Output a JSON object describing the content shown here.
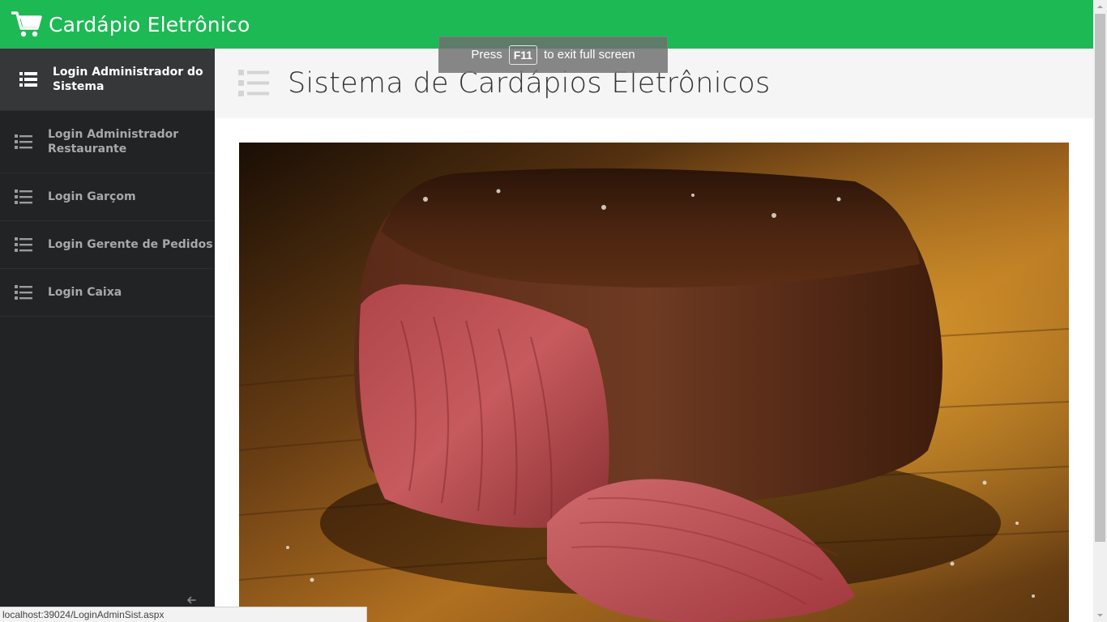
{
  "app": {
    "title": "Cardápio Eletrônico",
    "brand_color": "#1db954",
    "brand_icon": "shopping-cart-icon"
  },
  "sidebar": {
    "items": [
      {
        "label": "Login Administrador do Sistema",
        "icon": "list-icon",
        "active": true
      },
      {
        "label": "Login Administrador Restaurante",
        "icon": "list-icon",
        "active": false
      },
      {
        "label": "Login Garçom",
        "icon": "list-icon",
        "active": false
      },
      {
        "label": "Login Gerente de Pedidos",
        "icon": "list-icon",
        "active": false
      },
      {
        "label": "Login Caixa",
        "icon": "list-icon",
        "active": false
      }
    ],
    "collapse_icon": "arrow-left-icon"
  },
  "main": {
    "title": "Sistema de Cardápios Eletrônicos",
    "title_icon": "list-icon",
    "hero_image": "steak-on-cutting-board"
  },
  "fullscreen_notice": {
    "press": "Press",
    "key": "F11",
    "suffix": "to exit full screen"
  },
  "statusbar": {
    "url": "localhost:39024/LoginAdminSist.aspx"
  }
}
